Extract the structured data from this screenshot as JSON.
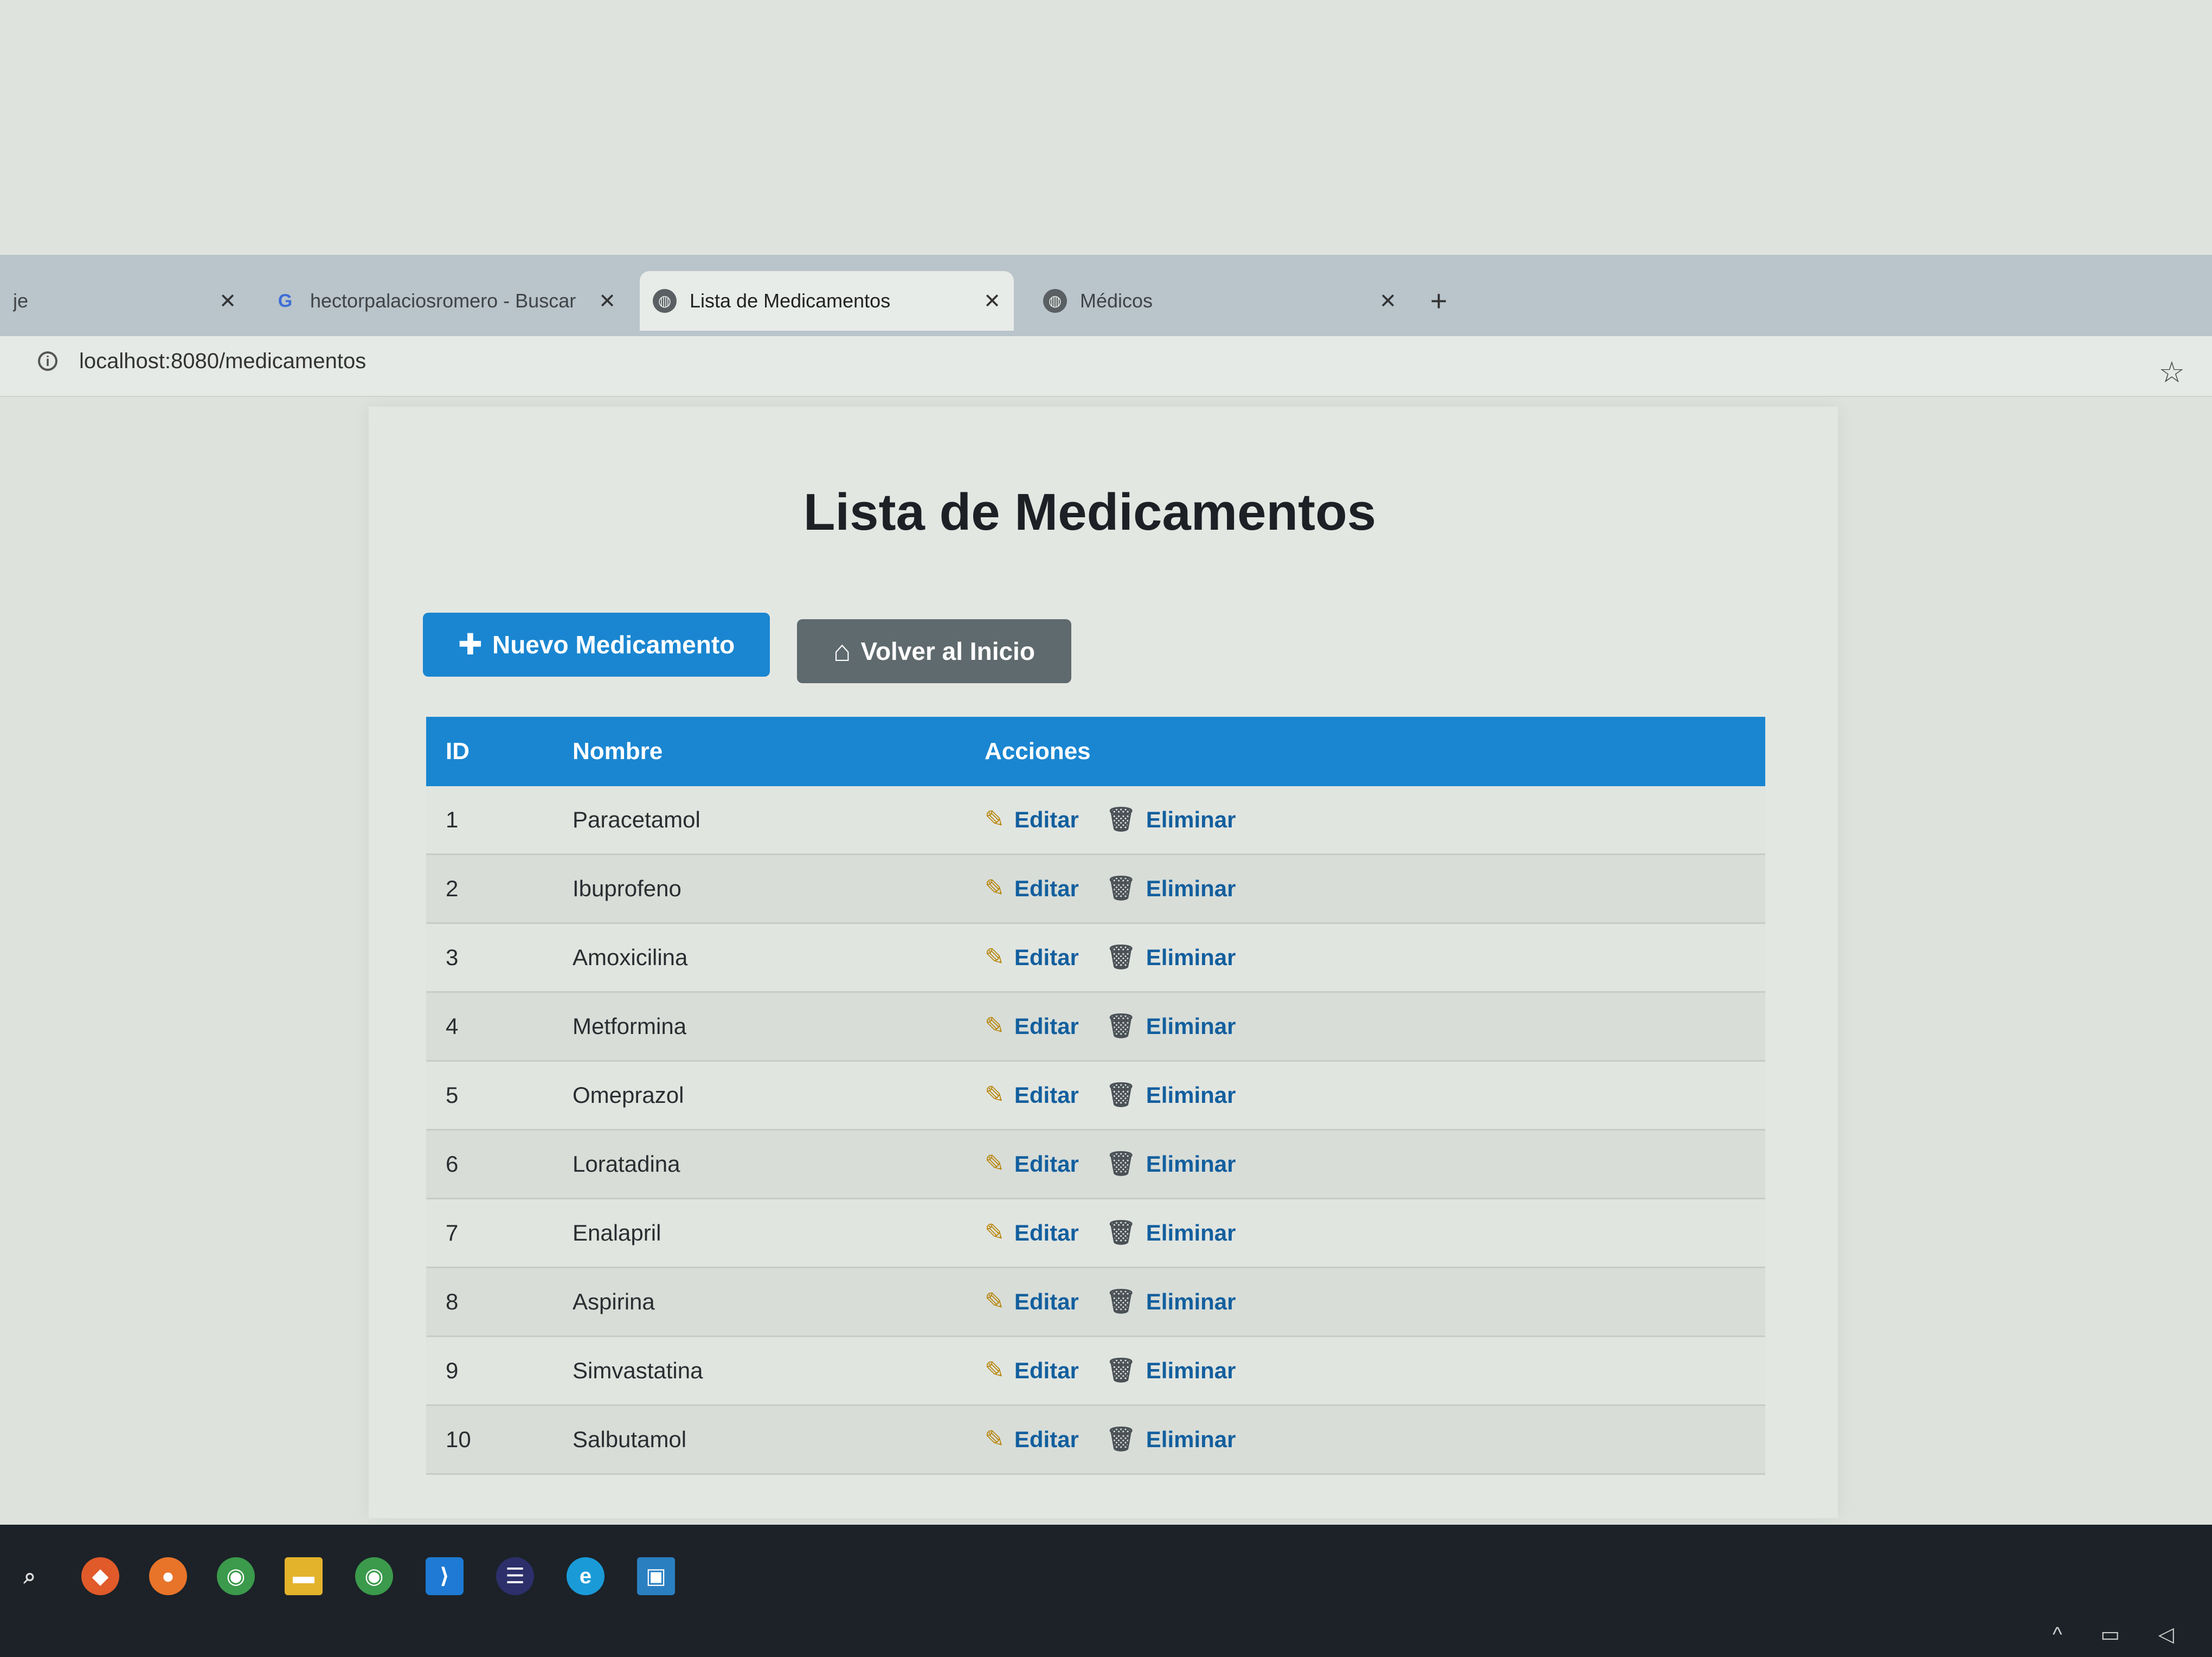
{
  "browser": {
    "tabs": [
      {
        "title": "je",
        "icon": "globe-icon",
        "active": false
      },
      {
        "title": "hectorpalaciosromero - Buscar",
        "icon": "google-icon",
        "active": false
      },
      {
        "title": "Lista de Medicamentos",
        "icon": "globe-icon",
        "active": true
      },
      {
        "title": "Médicos",
        "icon": "globe-icon",
        "active": false
      }
    ],
    "close_glyph": "✕",
    "new_tab_glyph": "+",
    "url": "localhost:8080/medicamentos"
  },
  "page": {
    "title": "Lista de Medicamentos",
    "new_button": "Nuevo Medicamento",
    "back_button": "Volver al Inicio"
  },
  "table": {
    "headers": {
      "id": "ID",
      "name": "Nombre",
      "actions": "Acciones"
    },
    "edit_label": "Editar",
    "delete_label": "Eliminar",
    "rows": [
      {
        "id": "1",
        "name": "Paracetamol"
      },
      {
        "id": "2",
        "name": "Ibuprofeno"
      },
      {
        "id": "3",
        "name": "Amoxicilina"
      },
      {
        "id": "4",
        "name": "Metformina"
      },
      {
        "id": "5",
        "name": "Omeprazol"
      },
      {
        "id": "6",
        "name": "Loratadina"
      },
      {
        "id": "7",
        "name": "Enalapril"
      },
      {
        "id": "8",
        "name": "Aspirina"
      },
      {
        "id": "9",
        "name": "Simvastatina"
      },
      {
        "id": "10",
        "name": "Salbutamol"
      }
    ]
  },
  "colors": {
    "primary": "#1a86d1",
    "secondary": "#5f6a6e",
    "link": "#135f9e"
  }
}
